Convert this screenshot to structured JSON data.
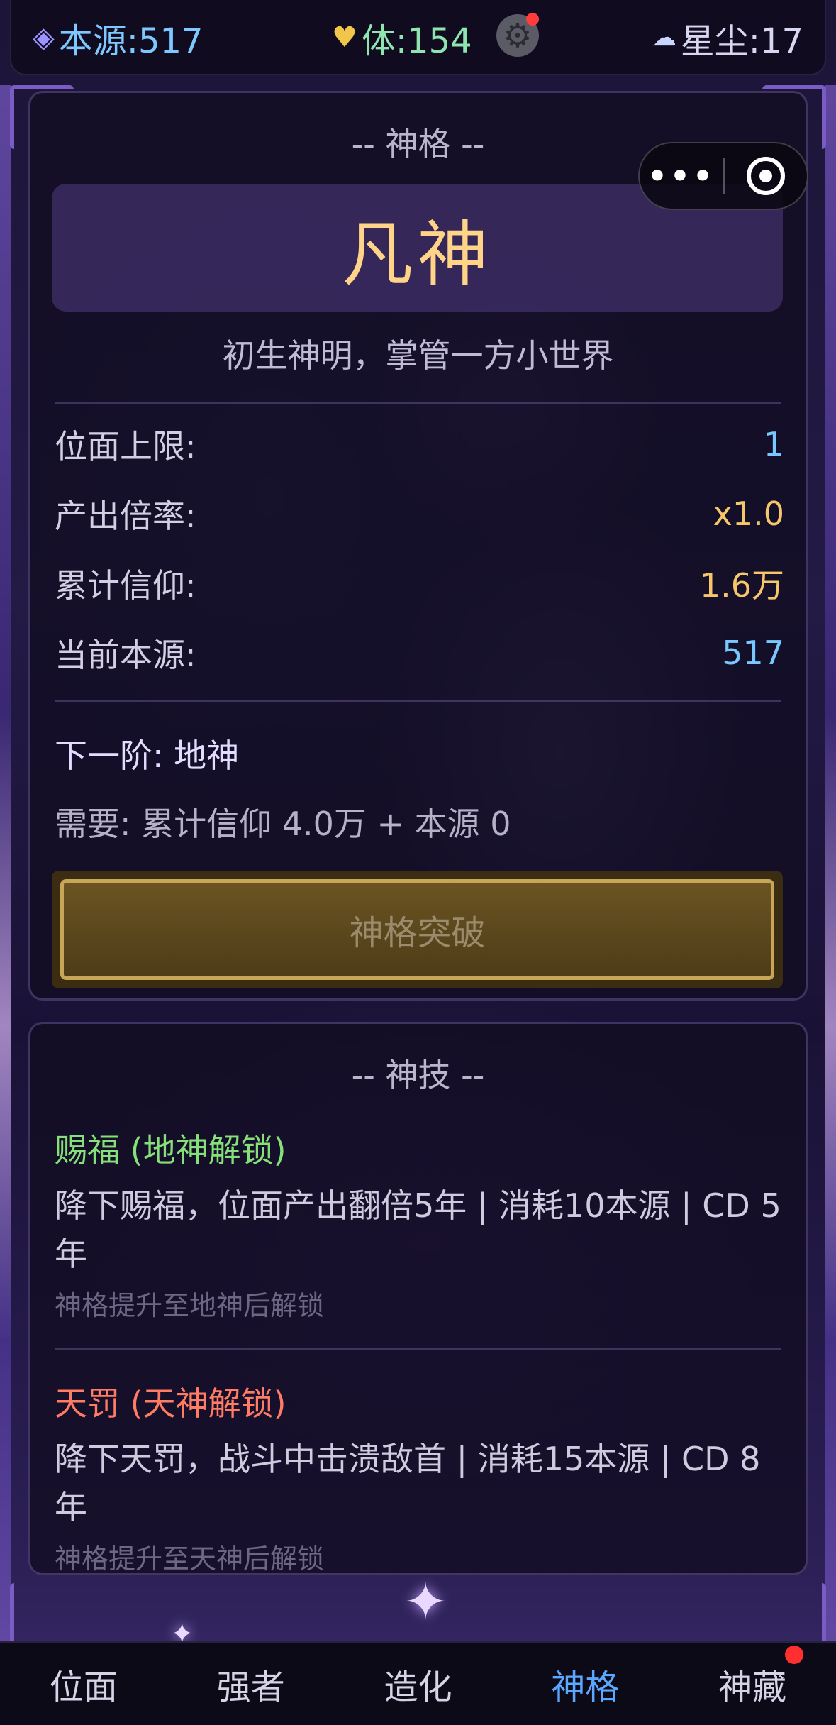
{
  "resources": {
    "origin": {
      "icon": "diamond-icon",
      "text": "本源:517"
    },
    "stamina": {
      "icon": "heart-icon",
      "text": "体:154"
    },
    "stardust": {
      "icon": "star-dust-icon",
      "text": "星尘:17"
    }
  },
  "godhood": {
    "section_title": "-- 神格 --",
    "rank_name": "凡神",
    "rank_desc": "初生神明，掌管一方小世界",
    "stats": [
      {
        "label": "位面上限:",
        "value": "1"
      },
      {
        "label": "产出倍率:",
        "value": "x1.0"
      },
      {
        "label": "累计信仰:",
        "value": "1.6万"
      },
      {
        "label": "当前本源:",
        "value": "517"
      }
    ],
    "next_rank": "下一阶: 地神",
    "requirement": "需要: 累计信仰 4.0万 + 本源 0",
    "breakthrough_label": "神格突破"
  },
  "skills": {
    "section_title": "-- 神技 --",
    "items": [
      {
        "name": "赐福 (地神解锁)",
        "desc": "降下赐福，位面产出翻倍5年 | 消耗10本源 | CD 5年",
        "lock": "神格提升至地神后解锁"
      },
      {
        "name": "天罚 (天神解锁)",
        "desc": "降下天罚，战斗中击溃敌首 | 消耗15本源 | CD 8年",
        "lock": "神格提升至天神后解锁"
      }
    ]
  },
  "nav": {
    "items": [
      "位面",
      "强者",
      "造化",
      "神格",
      "神藏"
    ],
    "active_index": 3
  },
  "colors": {
    "accent": "#5aa8ff",
    "gold": "#ffd488",
    "unlock_green": "#86e07a",
    "unlock_red": "#ff7b63"
  }
}
